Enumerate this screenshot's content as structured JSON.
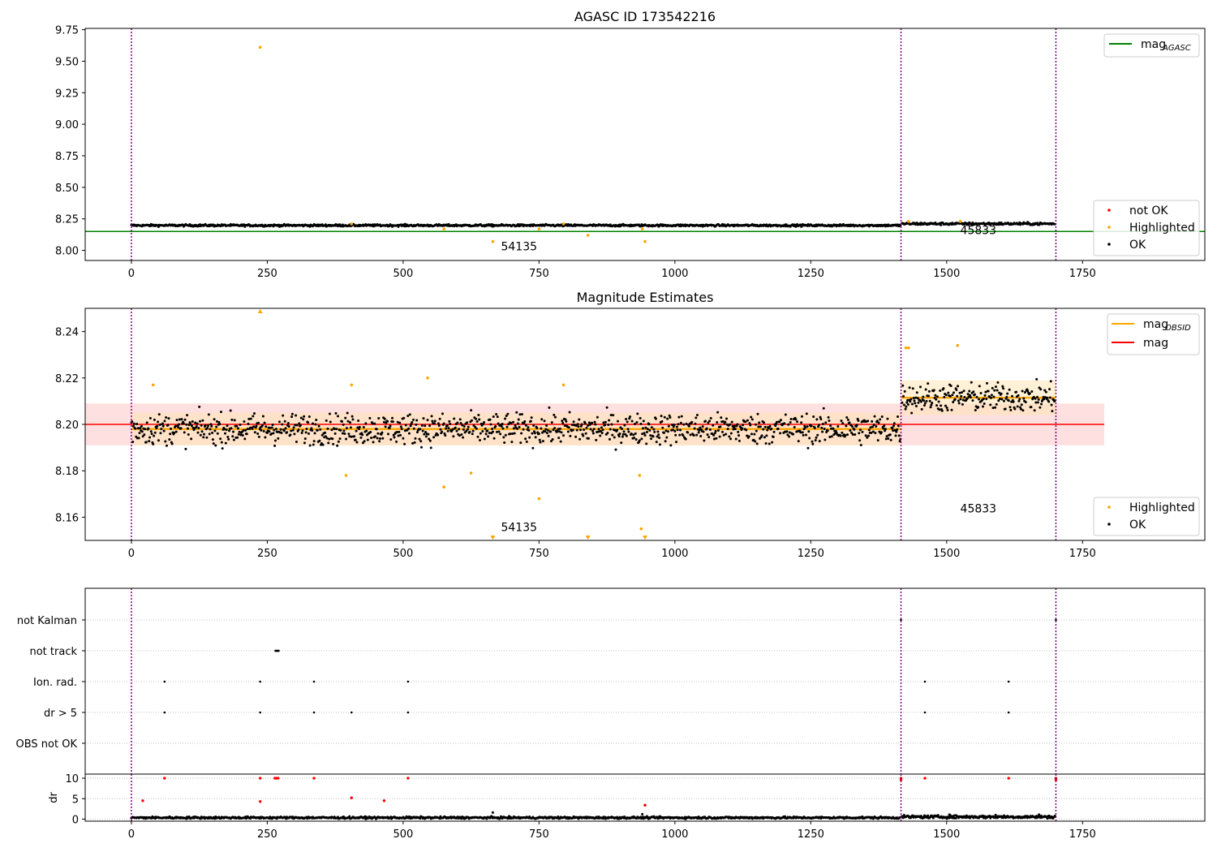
{
  "chart_data": [
    {
      "type": "scatter",
      "title": "AGASC ID 173542216",
      "xlim": [
        -85,
        1975
      ],
      "ylim": [
        7.92,
        9.76
      ],
      "xticks": [
        0,
        250,
        500,
        750,
        1000,
        1250,
        1500,
        1750
      ],
      "yticks": [
        8.0,
        8.25,
        8.5,
        8.75,
        9.0,
        9.25,
        9.5,
        9.75
      ],
      "ytick_labels": [
        "8.00",
        "8.25",
        "8.50",
        "8.75",
        "9.00",
        "9.25",
        "9.50",
        "9.75"
      ],
      "obs_boundaries": [
        0,
        1416,
        1701
      ],
      "obsid_labels": [
        {
          "text": "54135",
          "x": 680,
          "y": 8.0
        },
        {
          "text": "45833",
          "x": 1525,
          "y": 8.13
        }
      ],
      "mag_agasc": 8.15,
      "ok_segments": [
        {
          "x_start": 0,
          "x_end": 1415,
          "mean": 8.198,
          "spread": 0.008
        },
        {
          "x_start": 1418,
          "x_end": 1700,
          "mean": 8.211,
          "spread": 0.01
        }
      ],
      "highlighted_points": [
        {
          "x": 237,
          "y": 9.61
        },
        {
          "x": 665,
          "y": 8.07
        },
        {
          "x": 840,
          "y": 8.12
        },
        {
          "x": 945,
          "y": 8.07
        },
        {
          "x": 575,
          "y": 8.17
        },
        {
          "x": 750,
          "y": 8.17
        },
        {
          "x": 940,
          "y": 8.17
        },
        {
          "x": 405,
          "y": 8.21
        },
        {
          "x": 795,
          "y": 8.21
        },
        {
          "x": 1525,
          "y": 8.23
        },
        {
          "x": 1430,
          "y": 8.23
        }
      ],
      "legend_top": [
        {
          "label": "mag",
          "sub": "AGASC",
          "color": "#008000"
        }
      ],
      "legend_bottom": [
        {
          "label": "not OK",
          "color": "#ff0000"
        },
        {
          "label": "Highlighted",
          "color": "#ffa500"
        },
        {
          "label": "OK",
          "color": "#000000"
        }
      ]
    },
    {
      "type": "scatter",
      "title": "Magnitude Estimates",
      "xlim": [
        -85,
        1975
      ],
      "ylim": [
        8.15,
        8.25
      ],
      "xticks": [
        0,
        250,
        500,
        750,
        1000,
        1250,
        1500,
        1750
      ],
      "yticks": [
        8.16,
        8.18,
        8.2,
        8.22,
        8.24
      ],
      "ytick_labels": [
        "8.16",
        "8.18",
        "8.20",
        "8.22",
        "8.24"
      ],
      "obs_boundaries": [
        0,
        1416,
        1701
      ],
      "obsid_labels": [
        {
          "text": "54135",
          "x": 680,
          "y": 8.154
        },
        {
          "text": "45833",
          "x": 1525,
          "y": 8.162
        }
      ],
      "mag": 8.2,
      "mag_band": [
        8.191,
        8.209
      ],
      "mag_band_xrange": [
        -85,
        1790
      ],
      "mag_obsid": [
        {
          "x_start": 0,
          "x_end": 1416,
          "value": 8.198,
          "band": [
            8.191,
            8.205
          ]
        },
        {
          "x_start": 1416,
          "x_end": 1701,
          "value": 8.2115,
          "band": [
            8.204,
            8.219
          ]
        }
      ],
      "ok_segments": [
        {
          "x_start": 0,
          "x_end": 1415,
          "mean": 8.198,
          "spread": 0.0065
        },
        {
          "x_start": 1418,
          "x_end": 1700,
          "mean": 8.2115,
          "spread": 0.006
        }
      ],
      "highlighted_points": [
        {
          "x": 40,
          "y": 8.217
        },
        {
          "x": 405,
          "y": 8.217
        },
        {
          "x": 545,
          "y": 8.22
        },
        {
          "x": 795,
          "y": 8.217
        },
        {
          "x": 395,
          "y": 8.178
        },
        {
          "x": 575,
          "y": 8.173
        },
        {
          "x": 625,
          "y": 8.179
        },
        {
          "x": 750,
          "y": 8.168
        },
        {
          "x": 935,
          "y": 8.178
        },
        {
          "x": 938,
          "y": 8.155
        },
        {
          "x": 1425,
          "y": 8.233
        },
        {
          "x": 1430,
          "y": 8.233
        },
        {
          "x": 1520,
          "y": 8.234
        }
      ],
      "clipped_high": [
        {
          "x": 237
        }
      ],
      "clipped_low": [
        {
          "x": 665
        },
        {
          "x": 840
        },
        {
          "x": 945
        }
      ],
      "legend_top": [
        {
          "label": "mag",
          "sub": "OBSID",
          "color": "#ffa500"
        },
        {
          "label": "mag",
          "sub": "",
          "color": "#ff0000"
        }
      ],
      "legend_bottom": [
        {
          "label": "Highlighted",
          "color": "#ffa500"
        },
        {
          "label": "OK",
          "color": "#000000"
        }
      ]
    },
    {
      "type": "scatter",
      "title": "",
      "xlim": [
        -85,
        1975
      ],
      "categories": [
        "OBS not OK",
        "dr > 5",
        "Ion. rad.",
        "not track",
        "not Kalman"
      ],
      "flags": {
        "not Kalman": [
          1416,
          1701
        ],
        "not track": [
          265,
          266,
          267,
          268,
          269,
          270,
          271
        ],
        "Ion. rad.": [
          61,
          237,
          336,
          509,
          1460,
          1614
        ],
        "dr > 5": [
          61,
          237,
          336,
          405,
          509,
          1460,
          1614
        ],
        "OBS not OK": []
      }
    },
    {
      "type": "scatter",
      "title": "",
      "ylabel": "dr",
      "xlim": [
        -85,
        1975
      ],
      "ylim": [
        -0.5,
        11
      ],
      "xticks": [
        0,
        250,
        500,
        750,
        1000,
        1250,
        1500,
        1750
      ],
      "yticks": [
        0,
        5,
        10
      ],
      "ytick_labels": [
        "0",
        "5",
        "10"
      ],
      "obs_boundaries": [
        0,
        1416,
        1701
      ],
      "not_ok_points": [
        {
          "x": 21,
          "y": 4.5
        },
        {
          "x": 61,
          "y": 10
        },
        {
          "x": 237,
          "y": 4.3
        },
        {
          "x": 237,
          "y": 10
        },
        {
          "x": 264,
          "y": 10
        },
        {
          "x": 267,
          "y": 10
        },
        {
          "x": 270,
          "y": 10
        },
        {
          "x": 336,
          "y": 10
        },
        {
          "x": 405,
          "y": 5.2
        },
        {
          "x": 465,
          "y": 4.5
        },
        {
          "x": 509,
          "y": 10
        },
        {
          "x": 945,
          "y": 3.4
        },
        {
          "x": 1416,
          "y": 10
        },
        {
          "x": 1416,
          "y": 9.6
        },
        {
          "x": 1460,
          "y": 10
        },
        {
          "x": 1614,
          "y": 10
        },
        {
          "x": 1701,
          "y": 10
        },
        {
          "x": 1701,
          "y": 9.6
        }
      ],
      "ok_extra_points": [
        {
          "x": 665,
          "y": 1.6
        },
        {
          "x": 940,
          "y": 1.2
        },
        {
          "x": 1590,
          "y": 1.0
        },
        {
          "x": 1505,
          "y": 1.1
        },
        {
          "x": 1670,
          "y": 1.1
        }
      ],
      "ok_segments": [
        {
          "x_start": 0,
          "x_end": 1415,
          "mean": 0.35,
          "spread": 0.25
        },
        {
          "x_start": 1418,
          "x_end": 1700,
          "mean": 0.55,
          "spread": 0.35
        }
      ]
    }
  ],
  "colors": {
    "ok": "#000000",
    "highlighted": "#ffa500",
    "not_ok": "#ff0000",
    "agasc": "#008000",
    "mag": "#ff0000",
    "mag_band": "#ffcccc",
    "obsid": "#ffa500",
    "obsid_band": "#ffe4b5",
    "boundary": "#800080",
    "grid": "#b0b0b0"
  }
}
